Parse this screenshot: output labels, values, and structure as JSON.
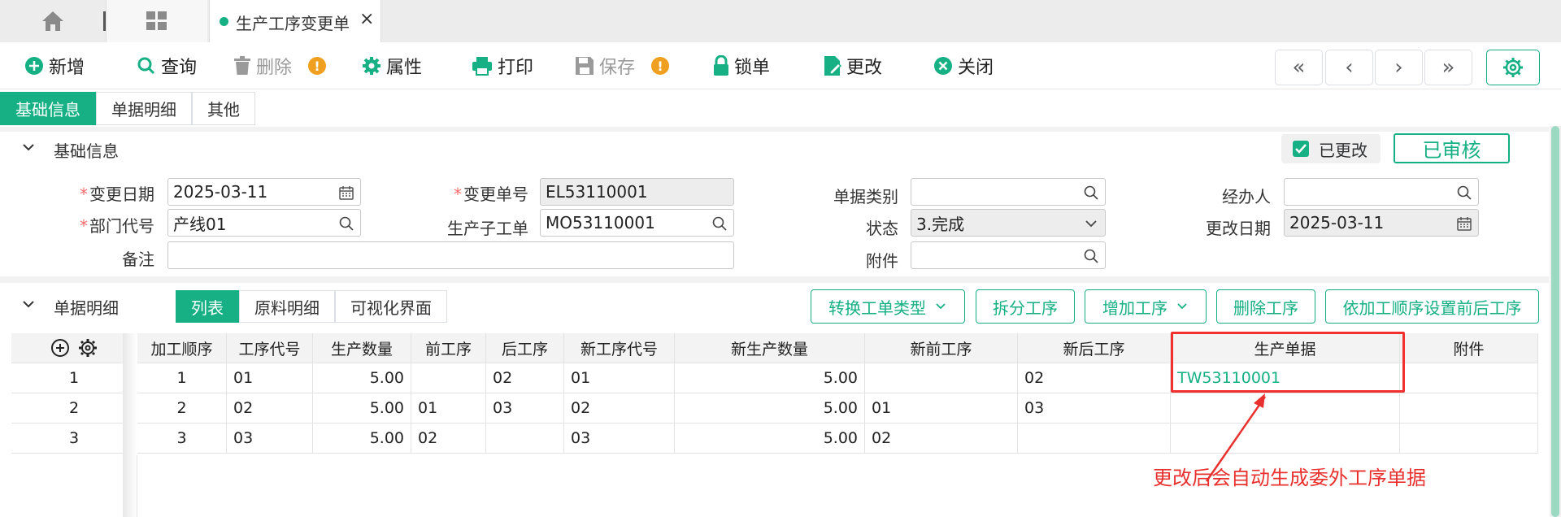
{
  "tabs": {
    "active_title": "生产工序变更单",
    "close": "×"
  },
  "toolbar": {
    "add": "新增",
    "query": "查询",
    "delete": "删除",
    "attr": "属性",
    "print": "打印",
    "save": "保存",
    "lock": "锁单",
    "modify": "更改",
    "close": "关闭",
    "warn_mark": "!",
    "nav": {
      "first": "«",
      "prev": "‹",
      "next": "›",
      "last": "»"
    }
  },
  "subtabs": [
    "基础信息",
    "单据明细",
    "其他"
  ],
  "basic": {
    "section_title": "基础信息",
    "changed_label": "已更改",
    "status_stamp": "已审核",
    "fields": {
      "change_date_label": "变更日期",
      "change_date": "2025-03-11",
      "dept_label": "部门代号",
      "dept": "产线01",
      "remark_label": "备注",
      "change_no_label": "变更单号",
      "change_no": "EL53110001",
      "sub_order_label": "生产子工单",
      "sub_order": "MO53110001",
      "doc_type_label": "单据类别",
      "doc_type": "",
      "status_label": "状态",
      "status": "3.完成",
      "attach_label": "附件",
      "attach": "",
      "handler_label": "经办人",
      "handler": "",
      "modify_date_label": "更改日期",
      "modify_date": "2025-03-11",
      "required_mark": "*"
    }
  },
  "detail": {
    "section_title": "单据明细",
    "view_tabs": [
      "列表",
      "原料明细",
      "可视化界面"
    ],
    "actions": {
      "convert": "转换工单类型",
      "split": "拆分工序",
      "add_proc": "增加工序",
      "del_proc": "删除工序",
      "set_order": "依加工顺序设置前后工序"
    },
    "columns": [
      "加工顺序",
      "工序代号",
      "生产数量",
      "前工序",
      "后工序",
      "新工序代号",
      "新生产数量",
      "新前工序",
      "新后工序",
      "生产单据",
      "附件"
    ],
    "rows": [
      {
        "idx": "1",
        "seq": "1",
        "code": "01",
        "qty": "5.00",
        "prev": "",
        "next": "02",
        "new_code": "01",
        "new_qty": "5.00",
        "new_prev": "",
        "new_next": "02",
        "doc": "TW53110001",
        "attach": ""
      },
      {
        "idx": "2",
        "seq": "2",
        "code": "02",
        "qty": "5.00",
        "prev": "01",
        "next": "03",
        "new_code": "02",
        "new_qty": "5.00",
        "new_prev": "01",
        "new_next": "03",
        "doc": "",
        "attach": ""
      },
      {
        "idx": "3",
        "seq": "3",
        "code": "03",
        "qty": "5.00",
        "prev": "02",
        "next": "",
        "new_code": "03",
        "new_qty": "5.00",
        "new_prev": "02",
        "new_next": "",
        "doc": "",
        "attach": ""
      }
    ]
  },
  "annotation": "更改后会自动生成委外工序单据",
  "colors": {
    "accent": "#16b084",
    "warn": "#f0a020",
    "annotation": "#e8312e"
  }
}
